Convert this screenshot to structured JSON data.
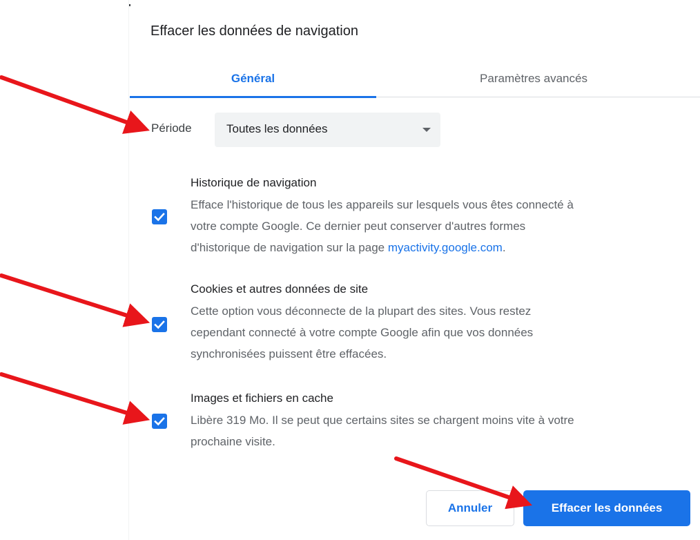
{
  "dialog": {
    "title": "Effacer les données de navigation"
  },
  "tabs": [
    {
      "label": "Général",
      "active": true
    },
    {
      "label": "Paramètres avancés",
      "active": false
    }
  ],
  "period": {
    "label": "Période",
    "selected": "Toutes les données"
  },
  "options": [
    {
      "title": "Historique de navigation",
      "desc_lines": [
        "Efface l'historique de tous les appareils sur lesquels vous êtes connecté à",
        "votre compte Google. Ce dernier peut conserver d'autres formes",
        "d'historique de navigation sur la page "
      ],
      "link": "myactivity.google.com",
      "link_suffix": ".",
      "checked": true
    },
    {
      "title": "Cookies et autres données de site",
      "desc_lines": [
        "Cette option vous déconnecte de la plupart des sites. Vous restez",
        "cependant connecté à votre compte Google afin que vos données",
        "synchronisées puissent être effacées."
      ],
      "checked": true
    },
    {
      "title": "Images et fichiers en cache",
      "desc_lines": [
        "Libère 319 Mo. Il se peut que certains sites se chargent moins vite à votre",
        "prochaine visite."
      ],
      "checked": true
    }
  ],
  "buttons": {
    "cancel": "Annuler",
    "clear": "Effacer les données"
  },
  "annotations": {
    "arrow_color": "#e8161b",
    "icon": "red-arrow-icon"
  },
  "colors": {
    "accent": "#1a73e8",
    "text": "#202124",
    "secondary_text": "#5f6368"
  }
}
